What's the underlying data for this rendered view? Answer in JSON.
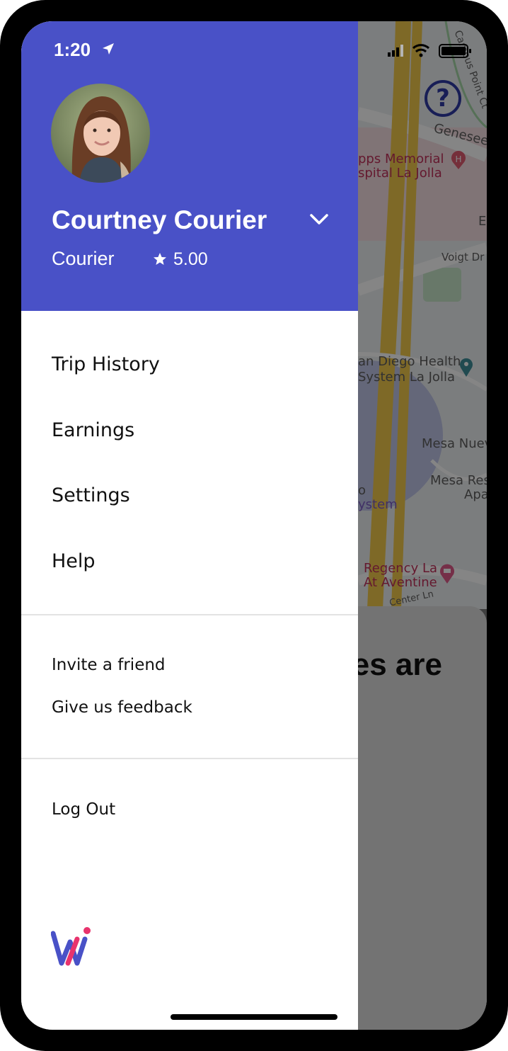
{
  "status_bar": {
    "time": "1:20",
    "location_icon": "location-arrow-icon",
    "signal_icon": "cellular-signal-icon",
    "wifi_icon": "wifi-icon",
    "battery_icon": "battery-icon"
  },
  "profile": {
    "name": "Courtney Courier",
    "role": "Courier",
    "rating": "5.00",
    "rating_icon": "star-icon",
    "expand_icon": "chevron-down-icon"
  },
  "menu": {
    "primary": [
      "Trip History",
      "Earnings",
      "Settings",
      "Help"
    ],
    "secondary": [
      "Invite a friend",
      "Give us feedback"
    ],
    "logout": "Log Out"
  },
  "background_map": {
    "labels": [
      "Campus Point Ct",
      "Genesee A",
      "pps Memorial",
      "spital La Jolla",
      "E",
      "Voigt Dr",
      "an Diego Health",
      "System La Jolla",
      "Mesa Nuev",
      "Mesa Res",
      "Apa",
      "ystem",
      "Regency La",
      "At Aventine",
      "Center Ln",
      "o"
    ],
    "help_icon": "question-mark-icon"
  },
  "background_sheet": {
    "title": "ges are"
  },
  "colors": {
    "header": "#4951c7",
    "help_accent": "#2f3aa6",
    "map_red": "#c0305a"
  }
}
